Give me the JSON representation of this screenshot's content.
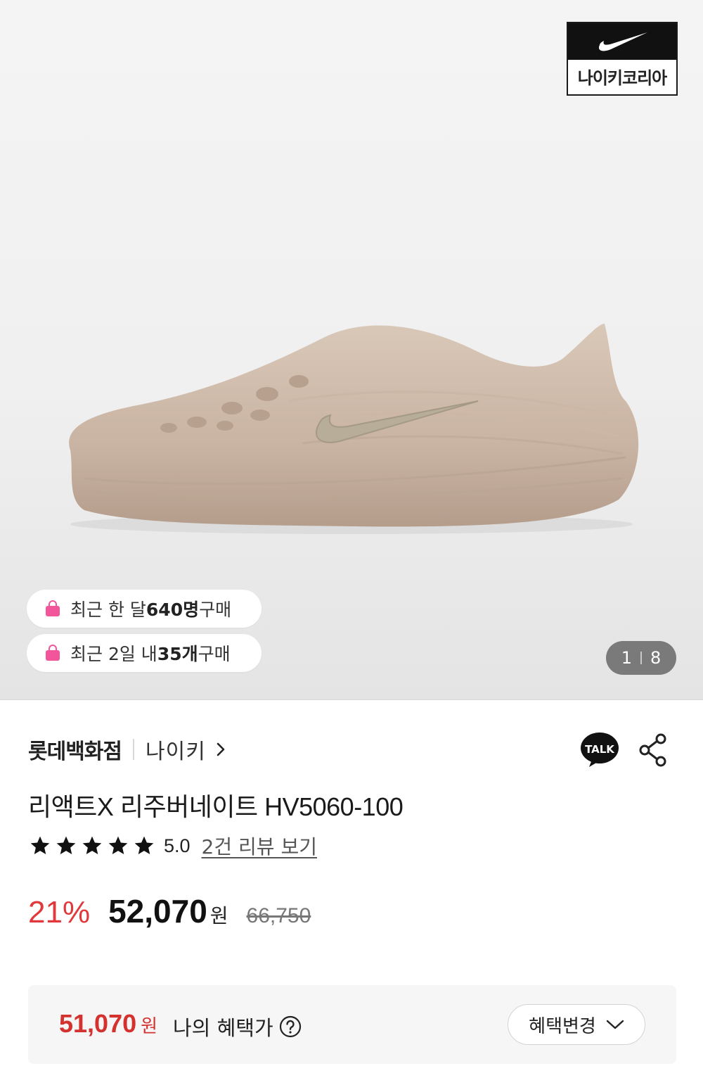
{
  "hero": {
    "brand_logo_text": "나이키코리아",
    "badges": [
      {
        "prefix": "최근 한 달 ",
        "highlight": "640명",
        "suffix": " 구매"
      },
      {
        "prefix": "최근 2일 내 ",
        "highlight": "35개",
        "suffix": " 구매"
      }
    ],
    "pager": {
      "current": "1",
      "total": "8"
    }
  },
  "seller": {
    "store": "롯데백화점",
    "brand": "나이키"
  },
  "actions": {
    "talk_label": "TALK"
  },
  "product": {
    "title": "리액트X 리주버네이트 HV5060-100",
    "rating": {
      "stars": 5,
      "score": "5.0",
      "review_link": "2건 리뷰 보기"
    },
    "price": {
      "discount": "21%",
      "sale_price": "52,070",
      "currency": "원",
      "original_price": "66,750"
    }
  },
  "benefit": {
    "price": "51,070",
    "currency": "원",
    "label": "나의 혜택가",
    "change_button": "혜택변경"
  },
  "colors": {
    "discount_red": "#e0383b",
    "benefit_red": "#d4322f",
    "bag_pink": "#f2559a",
    "pager_bg": "#7a7a7a"
  }
}
